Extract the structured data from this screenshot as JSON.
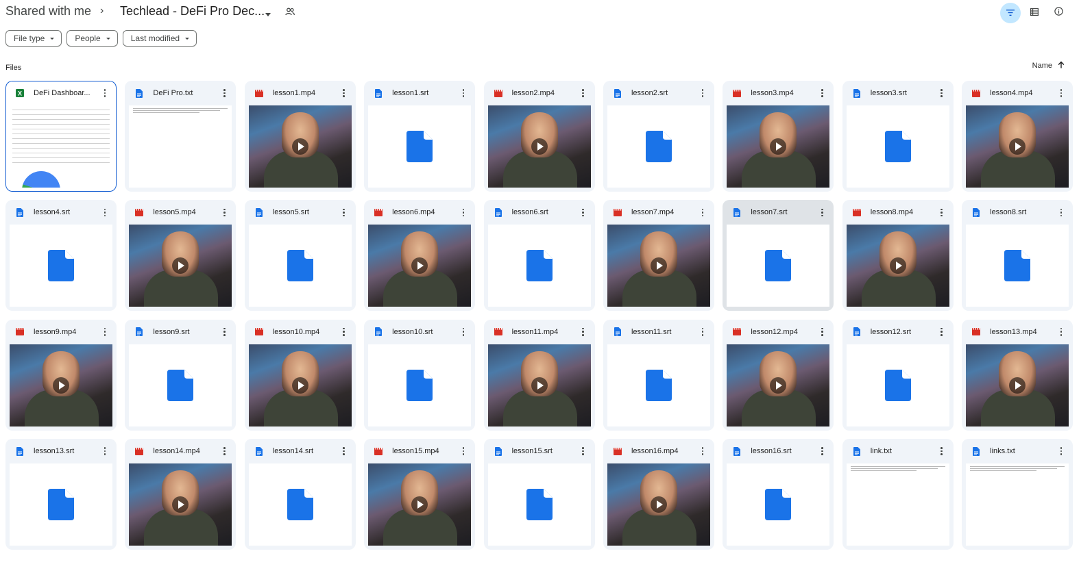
{
  "header": {
    "root": "Shared with me",
    "separator": "›",
    "current": "Techlead - DeFi Pro Dec..."
  },
  "filters": [
    "File type",
    "People",
    "Last modified"
  ],
  "section_label": "Files",
  "sort": {
    "label": "Name",
    "direction": "ascending"
  },
  "colors": {
    "accent": "#0b57d0",
    "video": "#d93025",
    "doc": "#1a73e8",
    "sheet": "#188038",
    "card": "#f0f4f9"
  },
  "files": [
    {
      "name": "DeFi Dashboar...",
      "type": "sheet"
    },
    {
      "name": "DeFi Pro.txt",
      "type": "text"
    },
    {
      "name": "lesson1.mp4",
      "type": "video"
    },
    {
      "name": "lesson1.srt",
      "type": "doc"
    },
    {
      "name": "lesson2.mp4",
      "type": "video"
    },
    {
      "name": "lesson2.srt",
      "type": "doc"
    },
    {
      "name": "lesson3.mp4",
      "type": "video"
    },
    {
      "name": "lesson3.srt",
      "type": "doc"
    },
    {
      "name": "lesson4.mp4",
      "type": "video"
    },
    {
      "name": "lesson4.srt",
      "type": "doc"
    },
    {
      "name": "lesson5.mp4",
      "type": "video"
    },
    {
      "name": "lesson5.srt",
      "type": "doc"
    },
    {
      "name": "lesson6.mp4",
      "type": "video"
    },
    {
      "name": "lesson6.srt",
      "type": "doc"
    },
    {
      "name": "lesson7.mp4",
      "type": "video"
    },
    {
      "name": "lesson7.srt",
      "type": "doc"
    },
    {
      "name": "lesson8.mp4",
      "type": "video"
    },
    {
      "name": "lesson8.srt",
      "type": "doc"
    },
    {
      "name": "lesson9.mp4",
      "type": "video"
    },
    {
      "name": "lesson9.srt",
      "type": "doc"
    },
    {
      "name": "lesson10.mp4",
      "type": "video"
    },
    {
      "name": "lesson10.srt",
      "type": "doc"
    },
    {
      "name": "lesson11.mp4",
      "type": "video"
    },
    {
      "name": "lesson11.srt",
      "type": "doc"
    },
    {
      "name": "lesson12.mp4",
      "type": "video"
    },
    {
      "name": "lesson12.srt",
      "type": "doc"
    },
    {
      "name": "lesson13.mp4",
      "type": "video"
    },
    {
      "name": "lesson13.srt",
      "type": "doc"
    },
    {
      "name": "lesson14.mp4",
      "type": "video"
    },
    {
      "name": "lesson14.srt",
      "type": "doc"
    },
    {
      "name": "lesson15.mp4",
      "type": "video"
    },
    {
      "name": "lesson15.srt",
      "type": "doc"
    },
    {
      "name": "lesson16.mp4",
      "type": "video"
    },
    {
      "name": "lesson16.srt",
      "type": "doc"
    },
    {
      "name": "link.txt",
      "type": "text"
    },
    {
      "name": "links.txt",
      "type": "text"
    }
  ],
  "selected_file": "DeFi Dashboar...",
  "hovered_file": "lesson7.srt"
}
